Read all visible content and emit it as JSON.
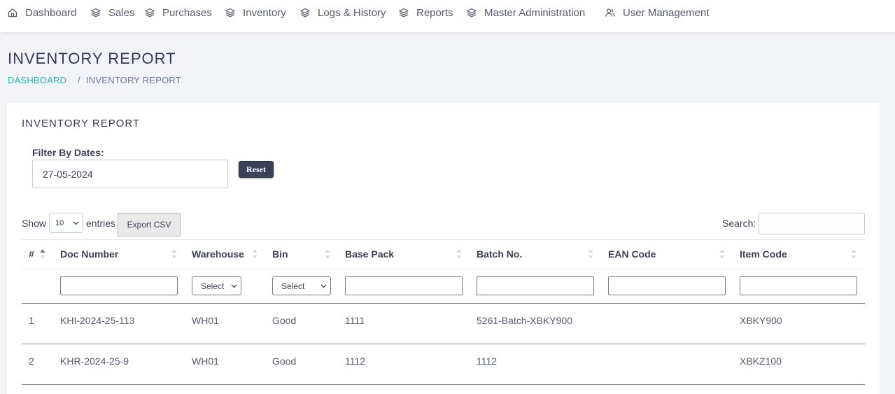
{
  "nav": {
    "items": [
      {
        "label": "Dashboard",
        "icon": "home-icon"
      },
      {
        "label": "Sales",
        "icon": "layers-icon"
      },
      {
        "label": "Purchases",
        "icon": "layers-icon"
      },
      {
        "label": "Inventory",
        "icon": "layers-icon"
      },
      {
        "label": "Logs & History",
        "icon": "layers-icon"
      },
      {
        "label": "Reports",
        "icon": "layers-icon"
      },
      {
        "label": "Master Administration",
        "icon": "layers-icon"
      },
      {
        "label": "User Management",
        "icon": "users-icon"
      }
    ]
  },
  "page": {
    "title": "INVENTORY REPORT",
    "breadcrumb": {
      "link": "DASHBOARD",
      "separator": "/",
      "current": "INVENTORY REPORT"
    }
  },
  "card": {
    "title": "INVENTORY REPORT",
    "filter_label": "Filter By Dates:",
    "date_value": "27-05-2024",
    "reset_label": "Reset"
  },
  "table_controls": {
    "show_label": "Show",
    "page_length": "10",
    "entries_label": "entries",
    "export_label": "Export CSV",
    "search_label": "Search:"
  },
  "table": {
    "columns": [
      "#",
      "Doc Number",
      "Warehouse",
      "Bin",
      "Base Pack",
      "Batch No.",
      "EAN Code",
      "Item Code"
    ],
    "warehouse_filter": "Select",
    "bin_filter": "Select",
    "rows": [
      {
        "num": "1",
        "doc": "KHI-2024-25-113",
        "warehouse": "WH01",
        "bin": "Good",
        "base_pack": "1111",
        "batch": "5261-Batch-XBKY900",
        "ean": "",
        "item": "XBKY900"
      },
      {
        "num": "2",
        "doc": "KHR-2024-25-9",
        "warehouse": "WH01",
        "bin": "Good",
        "base_pack": "1112",
        "batch": "1112",
        "ean": "",
        "item": "XBKZ100"
      }
    ]
  },
  "colors": {
    "accent": "#2ab3b0",
    "button_dark": "#3b4258",
    "text": "#34395e"
  }
}
